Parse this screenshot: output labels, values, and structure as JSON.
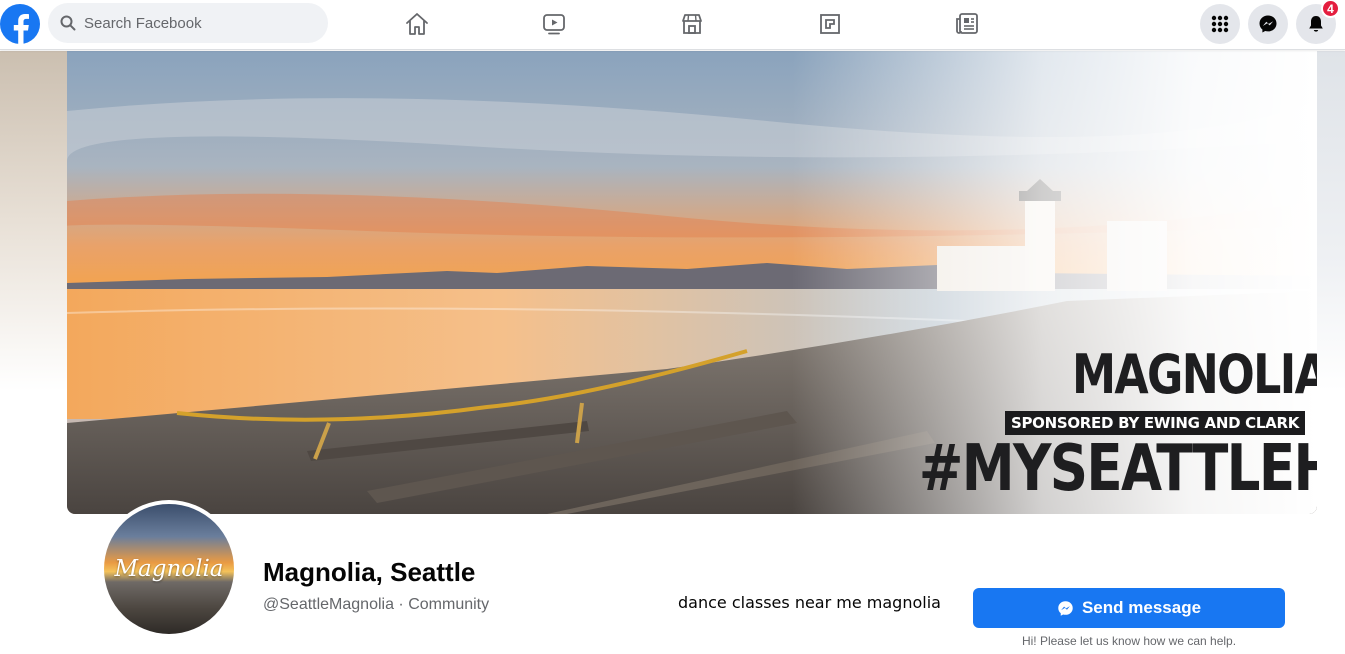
{
  "topbar": {
    "search": {
      "placeholder": "Search Facebook",
      "value": ""
    },
    "nav_icons": [
      "home-icon",
      "watch-icon",
      "marketplace-icon",
      "gaming-icon",
      "news-icon"
    ],
    "right_icons": [
      "menu-grid-icon",
      "messenger-icon",
      "notifications-icon"
    ],
    "notification_count": "4"
  },
  "cover": {
    "title": "MAGNOLIA",
    "sponsor": "SPONSORED BY EWING AND CLARK",
    "hashtag": "#MYSEATTLEHOOD"
  },
  "profile": {
    "avatar_text": "Magnolia",
    "name": "Magnolia, Seattle",
    "meta": "@SeattleMagnolia · Community"
  },
  "search_query": "dance classes near me magnolia",
  "actions": {
    "send_message_label": "Send message",
    "helper_text": "Hi! Please let us know how we can help."
  },
  "colors": {
    "brand": "#1877f2",
    "badge": "#e41e3f",
    "muted_text": "#65676b"
  }
}
